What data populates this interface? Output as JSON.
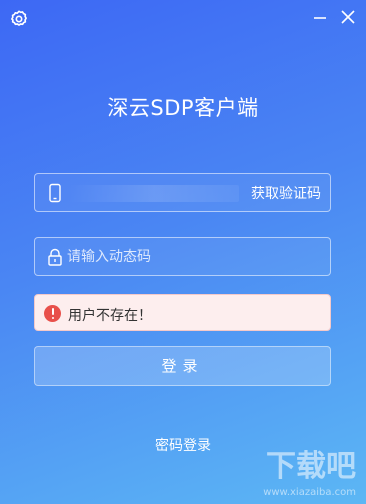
{
  "window": {
    "controls": [
      "settings-icon",
      "minimize-icon",
      "close-icon"
    ]
  },
  "header": {
    "title": "深云SDP客户端"
  },
  "phone_field": {
    "icon": "phone-icon",
    "get_code_label": "获取验证码"
  },
  "code_field": {
    "icon": "lock-icon",
    "placeholder": "请输入动态码",
    "value": ""
  },
  "error": {
    "icon": "error-icon",
    "message": "用户不存在！",
    "color": "#e8504b"
  },
  "login_button": {
    "label": "登录"
  },
  "footer": {
    "password_login_label": "密码登录"
  },
  "watermark": {
    "brand": "下载吧",
    "url": "www.xiazaiba.com"
  },
  "colors": {
    "gradient_start": "#3d68f4",
    "gradient_end": "#5cb7f4",
    "error_bg": "#fdeeee"
  }
}
